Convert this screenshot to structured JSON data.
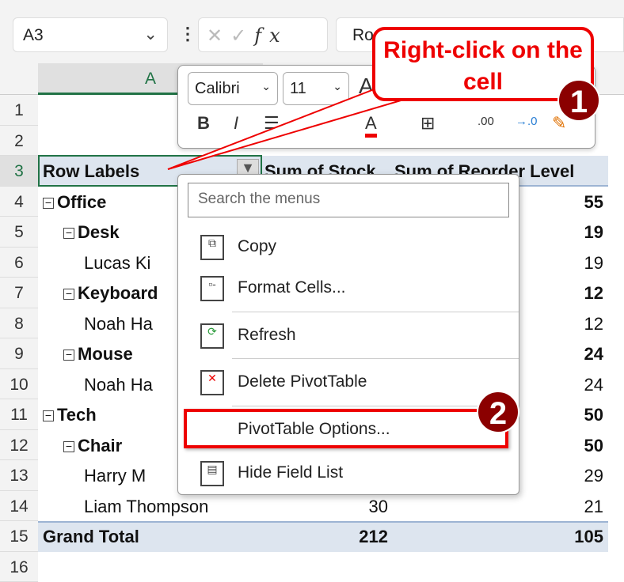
{
  "formula_bar": {
    "name_box": "A3",
    "formula": "Ro",
    "fx": "fx"
  },
  "column_header": "A",
  "rows": [
    "1",
    "2",
    "3",
    "4",
    "5",
    "6",
    "7",
    "8",
    "9",
    "10",
    "11",
    "12",
    "13",
    "14",
    "15",
    "16"
  ],
  "pivot": {
    "header": {
      "row_labels": "Row Labels",
      "col_b": "Sum of Stock",
      "col_c": "Sum of Reorder Level"
    },
    "items": [
      {
        "label": "Office",
        "level": 0,
        "b": "",
        "c": "55"
      },
      {
        "label": "Desk",
        "level": 1,
        "b": "",
        "c": "19"
      },
      {
        "label": "Lucas Ki",
        "level": 2,
        "b": "",
        "c": "19"
      },
      {
        "label": "Keyboard",
        "level": 1,
        "b": "",
        "c": "12"
      },
      {
        "label": "Noah Ha",
        "level": 2,
        "b": "",
        "c": "12"
      },
      {
        "label": "Mouse",
        "level": 1,
        "b": "",
        "c": "24"
      },
      {
        "label": "Noah Ha",
        "level": 2,
        "b": "",
        "c": "24"
      },
      {
        "label": "Tech",
        "level": 0,
        "b": "",
        "c": "50"
      },
      {
        "label": "Chair",
        "level": 1,
        "b": "",
        "c": "50"
      },
      {
        "label": "Harry M",
        "level": 2,
        "b": "",
        "c": "29"
      },
      {
        "label": "Liam Thompson",
        "level": 2,
        "b": "30",
        "c": "21"
      }
    ],
    "grand_total": {
      "label": "Grand Total",
      "b": "212",
      "c": "105"
    }
  },
  "mini_toolbar": {
    "font": "Calibri",
    "size": "11"
  },
  "context_menu": {
    "search_placeholder": "Search the menus",
    "items": [
      "Copy",
      "Format Cells...",
      "Refresh",
      "Delete PivotTable",
      "PivotTable Options...",
      "Hide Field List"
    ]
  },
  "annotations": {
    "callout": "Right-click on the cell",
    "step1": "1",
    "step2": "2"
  },
  "colors": {
    "accent": "#217346",
    "highlight": "#e00000",
    "badge": "#8b0000"
  }
}
